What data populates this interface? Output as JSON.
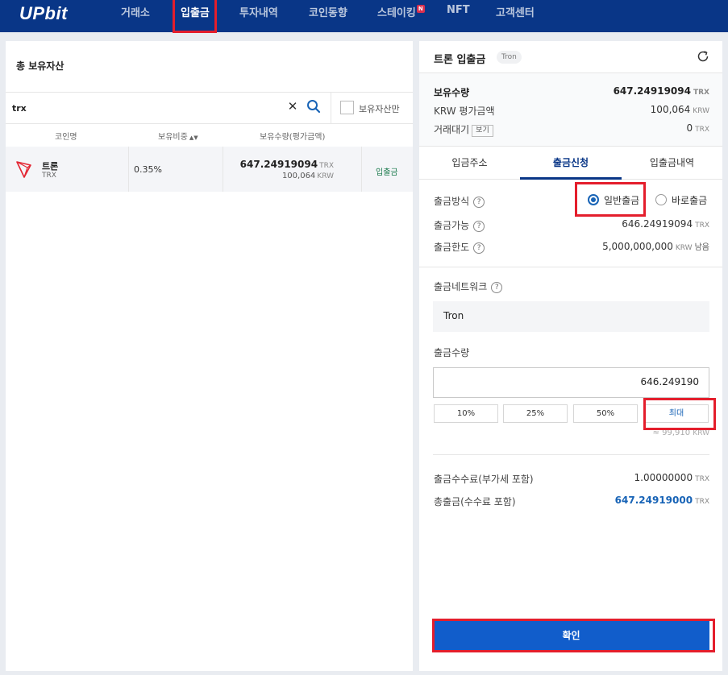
{
  "header": {
    "logo": "UPbit",
    "nav": [
      {
        "label": "거래소",
        "active": false
      },
      {
        "label": "입출금",
        "active": true
      },
      {
        "label": "투자내역",
        "active": false
      },
      {
        "label": "코인동향",
        "active": false
      },
      {
        "label": "스테이킹",
        "active": false,
        "badge": "N"
      },
      {
        "label": "NFT",
        "active": false
      },
      {
        "label": "고객센터",
        "active": false
      }
    ]
  },
  "left": {
    "title": "총 보유자산",
    "search": {
      "value": "trx",
      "owned_only_label": "보유자산만"
    },
    "columns": {
      "coin": "코인명",
      "ratio": "보유비중",
      "amount": "보유수량(평가금액)"
    },
    "rows": [
      {
        "name": "트론",
        "symbol": "TRX",
        "ratio": "0.35%",
        "amount": "647.24919094",
        "amount_unit": "TRX",
        "krw": "100,064",
        "krw_unit": "KRW",
        "action": "입출금"
      }
    ]
  },
  "right": {
    "title": "트론 입출금",
    "network_badge": "Tron",
    "holdings": {
      "qty_label": "보유수량",
      "qty_value": "647.24919094",
      "qty_unit": "TRX",
      "krw_label": "KRW 평가금액",
      "krw_value": "100,064",
      "krw_unit": "KRW",
      "pending_label": "거래대기",
      "pending_view": "보기",
      "pending_value": "0",
      "pending_unit": "TRX"
    },
    "tabs": [
      {
        "label": "입금주소",
        "active": false
      },
      {
        "label": "출금신청",
        "active": true
      },
      {
        "label": "입출금내역",
        "active": false
      }
    ],
    "method": {
      "label": "출금방식",
      "option_normal": "일반출금",
      "option_instant": "바로출금",
      "selected": "일반출금"
    },
    "available": {
      "label": "출금가능",
      "value": "646.24919094",
      "unit": "TRX"
    },
    "limit": {
      "label": "출금한도",
      "value": "5,000,000,000",
      "unit": "KRW",
      "suffix": "남음"
    },
    "network": {
      "label": "출금네트워크",
      "value": "Tron"
    },
    "amount": {
      "label": "출금수량",
      "value": "646.249190"
    },
    "pct_buttons": [
      "10%",
      "25%",
      "50%",
      "최대"
    ],
    "approx": {
      "value": "≈ 99,910",
      "unit": "KRW"
    },
    "fee": {
      "label": "출금수수료(부가세 포함)",
      "value": "1.00000000",
      "unit": "TRX"
    },
    "total": {
      "label": "총출금(수수료 포함)",
      "value": "647.24919000",
      "unit": "TRX"
    },
    "confirm_label": "확인"
  },
  "colors": {
    "brand_navy": "#093687",
    "accent_blue": "#115dcb",
    "highlight_red": "#e41e2c",
    "tron_red": "#e32633"
  }
}
